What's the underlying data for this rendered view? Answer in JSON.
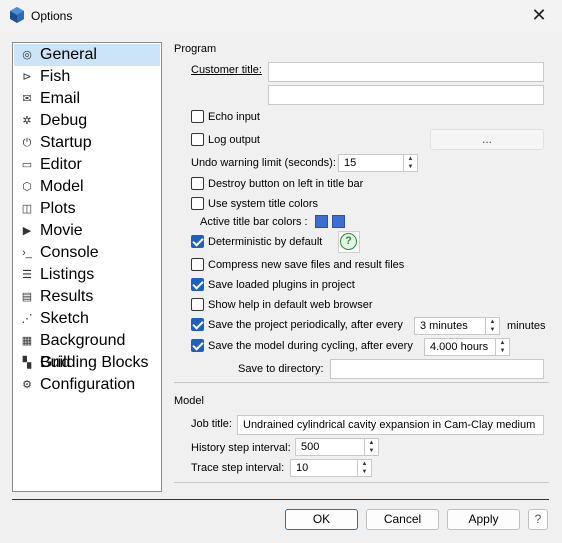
{
  "window": {
    "title": "Options",
    "close_icon": "✕"
  },
  "nav": {
    "items": [
      {
        "label": "General",
        "icon": "globe-icon",
        "glyph": "◎"
      },
      {
        "label": "Fish",
        "icon": "fish-icon",
        "glyph": "⊳"
      },
      {
        "label": "Email",
        "icon": "envelope-icon",
        "glyph": "✉"
      },
      {
        "label": "Debug",
        "icon": "bug-icon",
        "glyph": "✲"
      },
      {
        "label": "Startup",
        "icon": "power-icon",
        "glyph": "⏻"
      },
      {
        "label": "Editor",
        "icon": "editor-icon",
        "glyph": "▭"
      },
      {
        "label": "Model",
        "icon": "cube-icon",
        "glyph": "⬡"
      },
      {
        "label": "Plots",
        "icon": "plots-icon",
        "glyph": "◫"
      },
      {
        "label": "Movie",
        "icon": "movie-icon",
        "glyph": "▶"
      },
      {
        "label": "Console",
        "icon": "console-icon",
        "glyph": "›_"
      },
      {
        "label": "Listings",
        "icon": "listings-icon",
        "glyph": "☰"
      },
      {
        "label": "Results",
        "icon": "results-icon",
        "glyph": "▤"
      },
      {
        "label": "Sketch",
        "icon": "sketch-icon",
        "glyph": "⋰"
      },
      {
        "label": "Background Grid",
        "icon": "grid-icon",
        "glyph": "▦"
      },
      {
        "label": "Building Blocks",
        "icon": "blocks-icon",
        "glyph": "▚"
      },
      {
        "label": "Configuration",
        "icon": "gear-icon",
        "glyph": "⚙"
      }
    ],
    "selected": "General"
  },
  "program": {
    "group_label": "Program",
    "customer_title_label": "Customer title:",
    "customer_title_value": "",
    "customer_title_value2": "",
    "echo_input": "Echo input",
    "log_output": "Log output",
    "log_output_button": "...",
    "undo_label": "Undo warning limit (seconds):",
    "undo_value": "15",
    "destroy_button": "Destroy button on left in title bar",
    "system_title_colors": "Use system title colors",
    "active_title_bar_colors": "Active title bar colors :",
    "deterministic": "Deterministic by default",
    "compress": "Compress new save files and result files",
    "save_plugins": "Save loaded plugins in project",
    "show_help": "Show help in default web browser",
    "save_project": "Save the project periodically, after every",
    "save_project_value": "3 minutes",
    "minutes_label": "minutes",
    "save_model": "Save the model during cycling, after every",
    "save_model_value": "4.000 hours",
    "save_dir_label": "Save to directory:",
    "save_dir_value": "",
    "swatch_color": "#3d6fd0"
  },
  "checks": {
    "echo_input": false,
    "log_output": false,
    "destroy_button": false,
    "system_title_colors": false,
    "deterministic": true,
    "compress": false,
    "save_plugins": true,
    "show_help": false,
    "save_project": true,
    "save_model": true
  },
  "model": {
    "group_label": "Model",
    "job_title_label": "Job title:",
    "job_title_value": "Undrained cylindrical cavity expansion in Cam-Clay medium",
    "history_label": "History step interval:",
    "history_value": "500",
    "trace_label": "Trace step interval:",
    "trace_value": "10"
  },
  "footer": {
    "ok": "OK",
    "cancel": "Cancel",
    "apply": "Apply",
    "help": "?"
  }
}
